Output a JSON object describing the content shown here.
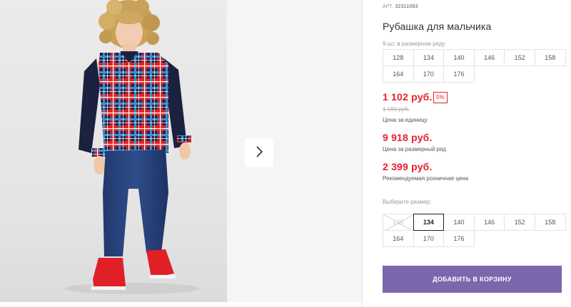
{
  "product": {
    "art_label": "АРТ.",
    "art_number": "32311083",
    "title": "Рубашка для мальчика",
    "row_note": "9 шт. в размерном ряду",
    "size_row": [
      "128",
      "134",
      "140",
      "146",
      "152",
      "158",
      "164",
      "170",
      "176"
    ]
  },
  "prices": {
    "unit_price": "1 102 руб.",
    "discount": "5%",
    "old_price": "1 160 руб.",
    "unit_label": "Цена за единицу",
    "row_price": "9 918 руб.",
    "row_label": "Цена за размерный ряд",
    "retail_price": "2 399 руб.",
    "retail_label": "Рекомендуемая розничная цена"
  },
  "size_select": {
    "label": "Выберите размер:",
    "options": [
      "128",
      "134",
      "140",
      "146",
      "152",
      "158",
      "164",
      "170",
      "176"
    ],
    "selected": "134",
    "unavailable": [
      "128"
    ]
  },
  "cart": {
    "button_label": "ДОБАВИТЬ В КОРЗИНУ"
  },
  "gallery": {
    "next_icon": "chevron-right-icon"
  },
  "colors": {
    "price_red": "#e5212a",
    "button_purple": "#7b67ac"
  }
}
